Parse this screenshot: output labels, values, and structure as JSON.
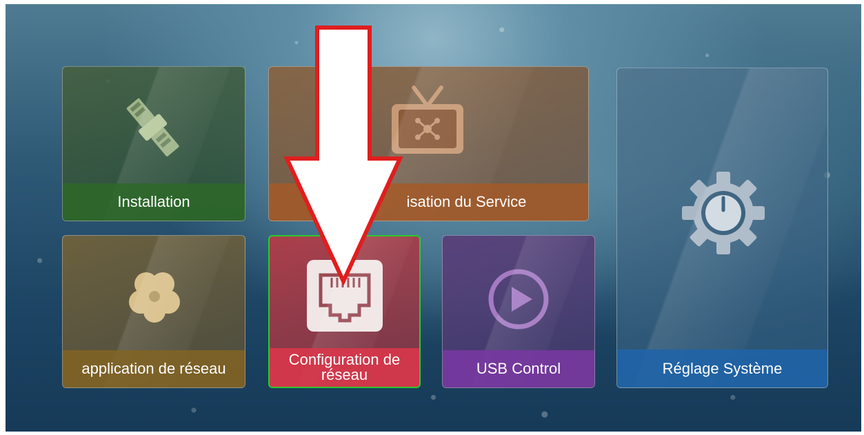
{
  "menu": {
    "tiles": [
      {
        "label": "Installation",
        "icon": "satellite-icon",
        "color": "#2d6928"
      },
      {
        "label": "isation du Service",
        "icon": "tv-icon",
        "color": "#a55a28"
      },
      {
        "label": "application de réseau",
        "icon": "clover-icon",
        "color": "#826423"
      },
      {
        "label": "Configuration de réseau",
        "icon": "ethernet-port-icon",
        "color": "#d7374b",
        "selected": true
      },
      {
        "label": "USB Control",
        "icon": "play-icon",
        "color": "#7837a0"
      },
      {
        "label": "Réglage Système",
        "icon": "gear-power-icon",
        "color": "#1e64aa"
      }
    ]
  },
  "annotation": {
    "icon": "down-arrow-icon",
    "fill": "#ffffff",
    "stroke": "#e01e1e"
  }
}
